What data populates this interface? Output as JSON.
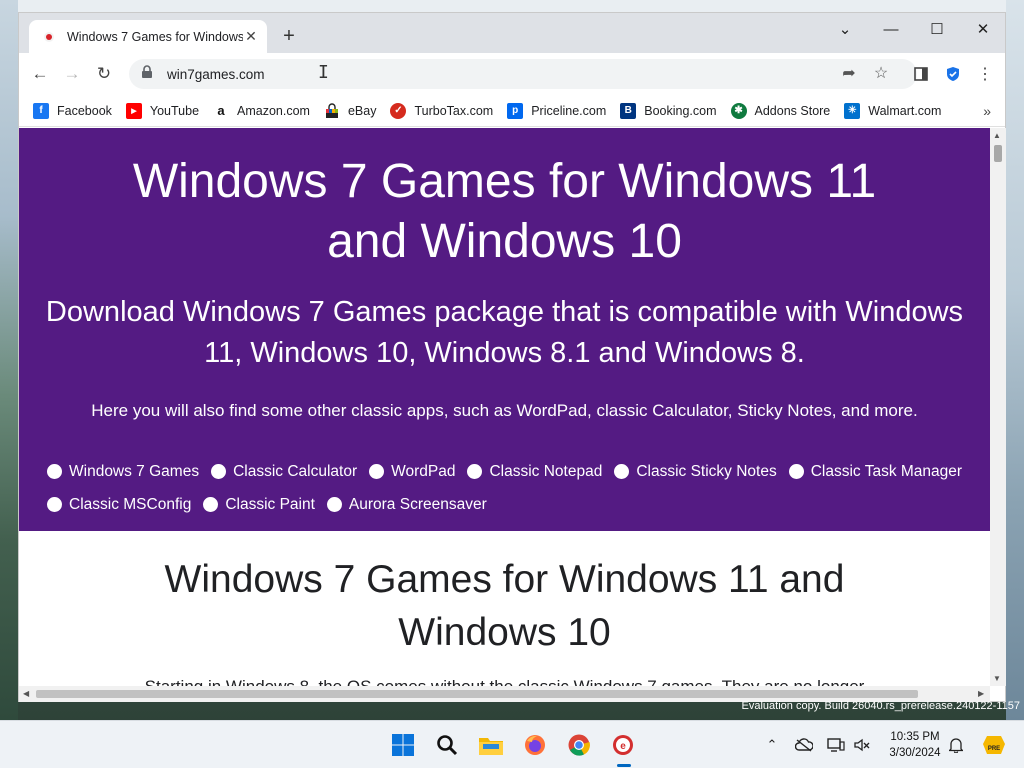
{
  "browser": {
    "tab": {
      "title": "Windows 7 Games for Windows"
    },
    "url": "win7games.com",
    "bookmarks": [
      {
        "label": "Facebook",
        "icon": "facebook-icon",
        "color": "#1877f2",
        "glyph": "f"
      },
      {
        "label": "YouTube",
        "icon": "youtube-icon",
        "color": "#ff0000",
        "glyph": "▶"
      },
      {
        "label": "Amazon.com",
        "icon": "amazon-icon",
        "color": "#ffffff",
        "glyph": "a"
      },
      {
        "label": "eBay",
        "icon": "ebay-icon",
        "color": "#ffffff",
        "glyph": ""
      },
      {
        "label": "TurboTax.com",
        "icon": "turbotax-icon",
        "color": "#d52b1e",
        "glyph": "✓"
      },
      {
        "label": "Priceline.com",
        "icon": "priceline-icon",
        "color": "#0068ef",
        "glyph": "p"
      },
      {
        "label": "Booking.com",
        "icon": "booking-icon",
        "color": "#003580",
        "glyph": "B"
      },
      {
        "label": "Addons Store",
        "icon": "addons-store-icon",
        "color": "#0f7a3f",
        "glyph": "✱"
      },
      {
        "label": "Walmart.com",
        "icon": "walmart-icon",
        "color": "#0071ce",
        "glyph": "✳"
      }
    ]
  },
  "page": {
    "hero_title": "Windows 7 Games for Windows 11 and Windows 10",
    "hero_subtitle": "Download Windows 7 Games package that is compatible with Windows 11, Windows 10, Windows 8.1 and Windows 8.",
    "hero_intro": "Here you will also find some other classic apps, such as WordPad, classic Calculator, Sticky Notes, and more.",
    "nav_options": [
      "Windows 7 Games",
      "Classic Calculator",
      "WordPad",
      "Classic Notepad",
      "Classic Sticky Notes",
      "Classic Task Manager",
      "Classic MSConfig",
      "Classic Paint",
      "Aurora Screensaver"
    ],
    "section_title": "Windows 7 Games for Windows 11 and Windows 10",
    "section_text": "Starting in Windows 8, the OS comes without the classic Windows 7 games. They are no longer"
  },
  "desktop": {
    "watermark": "Evaluation copy. Build 26040.rs_prerelease.240122-1157"
  },
  "taskbar": {
    "time": "10:35 PM",
    "date": "3/30/2024"
  },
  "colors": {
    "hero_bg": "#541b83",
    "accent": "#0067c0"
  }
}
